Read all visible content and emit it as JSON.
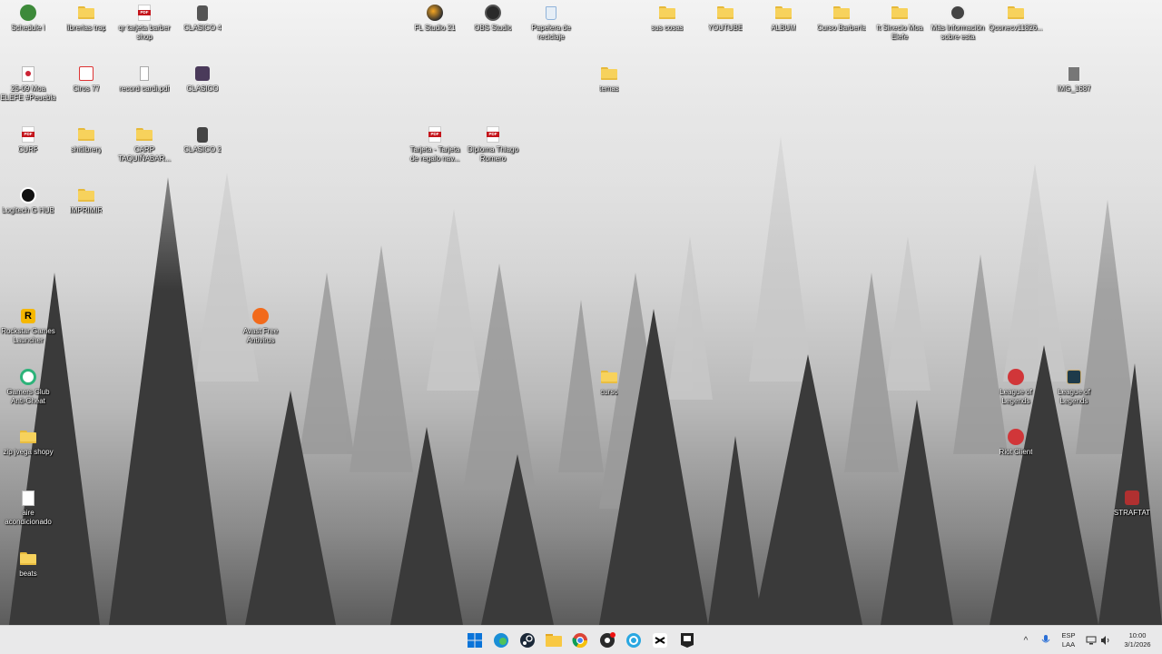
{
  "desktop": {
    "icons": {
      "schedule": "Schedule I",
      "librerias": "librerias trap",
      "qr_tarjeta": "qr tarjeta barber shop",
      "clasico4": "CLASICO 4",
      "fl_studio": "FL Studio 21",
      "obs": "OBS Studio",
      "papelera": "Papelera de reciclaje",
      "sus_cosas": "sus cosas",
      "youtube": "YOUTUBE",
      "album": "ALBUM",
      "curso_barberia": "Curso Barbería",
      "sinecio": "ft Sinecio Moa Elefe",
      "mas_info": "Más información sobre esta imag...",
      "qconecv": "Qconecv11826...",
      "audio_file": "25-09 Moa ELEFE #Peuebla",
      "ciros": "Ciros 77",
      "record_cardi": "record cardi.pdf",
      "clasico": "CLASICO",
      "temas": "temas",
      "img": "IMG_1687",
      "curp": "CURP",
      "shitlibrery": "shitlibrery",
      "carp_taquina": "CARP TAQUIÑABAR...",
      "clasico2": "CLASICO 2",
      "tarjeta_regalo": "Tarjeta - Tarjeta de regalo nav...",
      "diploma": "Diploma Thiago Romero",
      "logitech": "Logitech G HUB",
      "imprimir": "IMPRIMIR",
      "rockstar": "Rockstar Games Launcher",
      "avast": "Avast Free Antivirus",
      "gamers_club": "Gamers Club Anti-Cheat",
      "curso": "curso",
      "lol1": "League of Legends",
      "lol2": "League of Legends",
      "zip_jvega": "zip jvega shopy",
      "riot": "Riot Client",
      "aire": "aire acondicionado",
      "strafat": "STRAFTAT",
      "beats": "beats"
    }
  },
  "taskbar": {
    "apps": [
      "windows-start",
      "edge",
      "steam",
      "file-explorer",
      "chrome",
      "obs",
      "copilot",
      "capcut",
      "epic-games"
    ],
    "tray": {
      "language_line1": "ESP",
      "language_line2": "LAA",
      "time": "10:00",
      "date": "3/1/2026"
    }
  },
  "colors": {
    "taskbar_bg": "#e9e9ea",
    "folder_yellow": "#f7d25c",
    "pdf_red": "#c4141b",
    "riot_red": "#d13639"
  }
}
